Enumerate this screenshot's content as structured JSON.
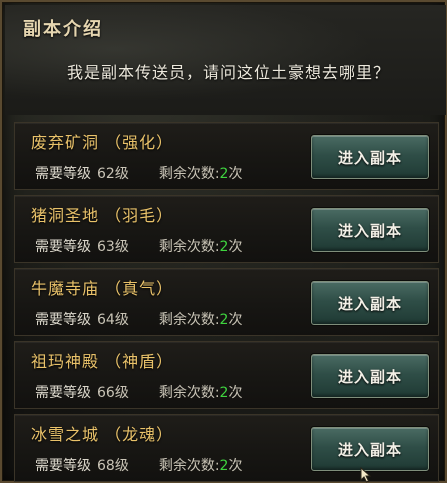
{
  "panel": {
    "title": "副本介绍",
    "greeting": "我是副本传送员，请问这位土豪想去哪里？"
  },
  "labels": {
    "level_label": "需要等级",
    "level_unit": "级",
    "remaining_label": "剩余次数:",
    "remaining_unit": "次",
    "enter_button": "进入副本"
  },
  "dungeons": [
    {
      "name": "废弃矿洞 （强化）",
      "level": "62",
      "remaining": "2"
    },
    {
      "name": "猪洞圣地 （羽毛）",
      "level": "63",
      "remaining": "2"
    },
    {
      "name": "牛魔寺庙 （真气）",
      "level": "64",
      "remaining": "2"
    },
    {
      "name": "祖玛神殿 （神盾）",
      "level": "66",
      "remaining": "2"
    },
    {
      "name": "冰雪之城 （龙魂）",
      "level": "68",
      "remaining": "2"
    }
  ],
  "colors": {
    "name_gold": "#e9c26a",
    "count_green": "#3fd43f",
    "button_teal": "#2f4e47"
  }
}
